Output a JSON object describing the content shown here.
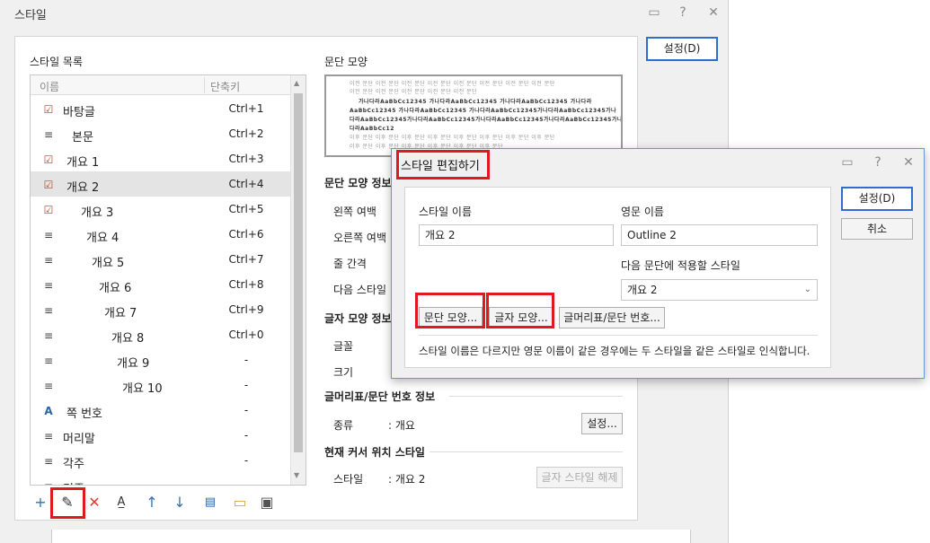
{
  "window": {
    "title": "스타일"
  },
  "style_list": {
    "label": "스타일 목록",
    "col_name": "이름",
    "col_shortcut": "단축키",
    "items": [
      {
        "name": "바탕글",
        "shortcut": "Ctrl+1",
        "icon": "checkmark-icon"
      },
      {
        "name": "본문",
        "shortcut": "Ctrl+2",
        "icon": "paragraph-lines-icon"
      },
      {
        "name": "개요 1",
        "shortcut": "Ctrl+3",
        "icon": "checkmark-icon"
      },
      {
        "name": "개요 2",
        "shortcut": "Ctrl+4",
        "icon": "checkmark-icon",
        "selected": true
      },
      {
        "name": "개요 3",
        "shortcut": "Ctrl+5",
        "icon": "checkmark-icon"
      },
      {
        "name": "개요 4",
        "shortcut": "Ctrl+6",
        "icon": "paragraph-lines-icon"
      },
      {
        "name": "개요 5",
        "shortcut": "Ctrl+7",
        "icon": "paragraph-lines-icon"
      },
      {
        "name": "개요 6",
        "shortcut": "Ctrl+8",
        "icon": "paragraph-lines-icon"
      },
      {
        "name": "개요 7",
        "shortcut": "Ctrl+9",
        "icon": "paragraph-lines-icon"
      },
      {
        "name": "개요 8",
        "shortcut": "Ctrl+0",
        "icon": "paragraph-lines-icon"
      },
      {
        "name": "개요 9",
        "shortcut": "-",
        "icon": "paragraph-lines-icon"
      },
      {
        "name": "개요 10",
        "shortcut": "-",
        "icon": "paragraph-lines-icon"
      },
      {
        "name": "쪽 번호",
        "shortcut": "-",
        "icon": "char-style-icon"
      },
      {
        "name": "머리말",
        "shortcut": "-",
        "icon": "paragraph-lines-icon"
      },
      {
        "name": "각주",
        "shortcut": "-",
        "icon": "paragraph-lines-icon"
      },
      {
        "name": "미주",
        "shortcut": "-",
        "icon": "paragraph-lines-icon"
      }
    ]
  },
  "preview": {
    "label": "문단 모양",
    "lines_gray_1": "이전 문단 이전 문단 이전 문단 이전 문단 이전 문단 이전 문단 이전 문단 이전 문단",
    "lines_gray_2": "이전 문단 이전 문단 이전 문단 이전 문단 이전 문단",
    "lines_dark_1": "가나다라AaBbCc12345   가나다라AaBbCc12345   가나다라AaBbCc12345   가나다라",
    "lines_dark_2": "AaBbCc12345   가나다라AaBbCc12345   가나다라AaBbCc12345가나다라AaBbCc12345가나",
    "lines_dark_3": "다라AaBbCc12345가나다라AaBbCc12345가나다라AaBbCc12345가나다라AaBbCc12345가나",
    "lines_dark_4": "다라AaBbCc12",
    "lines_gray_3": "이후 문단 이후 문단 이후 문단 이후 문단 이후 문단 이후 문단 이후 문단 이후 문단",
    "lines_gray_4": "이후 문단 이후 문단 이후 문단 이후 문단 이후 문단 이후 문단"
  },
  "para_info": {
    "title": "문단 모양 정보",
    "left_margin": "왼쪽 여백",
    "right_margin": "오른쪽 여백",
    "line_spacing": "줄 간격",
    "next_style": "다음 스타일"
  },
  "char_info": {
    "title": "글자 모양 정보",
    "font": "글꼴",
    "size": "크기"
  },
  "bullet_info": {
    "title": "글머리표/문단 번호 정보",
    "kind_label": "종류",
    "kind_value": ": 개요",
    "settings_btn": "설정..."
  },
  "cursor_style": {
    "title": "현재 커서 위치 스타일",
    "style_label": "스타일",
    "style_value": ": 개요 2",
    "release_btn": "글자 스타일 해제"
  },
  "main_buttons": {
    "ok": "설정(D)"
  },
  "dialog": {
    "title": "스타일 편집하기",
    "style_name_label": "스타일 이름",
    "style_name_value": "개요 2",
    "english_name_label": "영문 이름",
    "english_name_value": "Outline 2",
    "next_style_label": "다음 문단에 적용할 스타일",
    "next_style_value": "개요 2",
    "para_shape_btn": "문단 모양...",
    "char_shape_btn": "글자 모양...",
    "bullet_btn": "글머리표/문단 번호...",
    "note": "스타일 이름은 다르지만 영문 이름이 같은 경우에는 두 스타일을 같은 스타일로 인식합니다.",
    "ok_btn": "설정(D)",
    "cancel_btn": "취소"
  },
  "titlebar_icons": {
    "help": "?",
    "close": "✕"
  }
}
